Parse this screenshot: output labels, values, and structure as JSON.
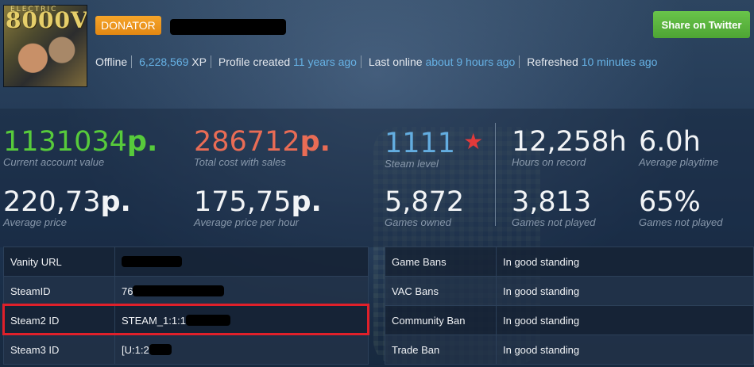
{
  "header": {
    "avatar_text": "8000V",
    "avatar_small": "ELECTRIC",
    "badge": "DONATOR",
    "share_button": "Share on Twitter",
    "status": "Offline",
    "xp_value": "6,228,569",
    "xp_unit": "XP",
    "created_label": "Profile created",
    "created_value": "11 years ago",
    "last_online_label": "Last online",
    "last_online_value": "about 9 hours ago",
    "refreshed_label": "Refreshed",
    "refreshed_value": "10 minutes ago"
  },
  "stats": {
    "account_value": {
      "value": "1131034",
      "currency": "p.",
      "label": "Current account value"
    },
    "total_cost": {
      "value": "286712",
      "currency": "p.",
      "label": "Total cost with sales"
    },
    "steam_level": {
      "value": "1111",
      "label": "Steam level"
    },
    "hours": {
      "value": "12,258h",
      "label": "Hours on record"
    },
    "avg_playtime": {
      "value": "6.0h",
      "label": "Average playtime"
    },
    "avg_price": {
      "value": "220,73",
      "currency": "p.",
      "label": "Average price"
    },
    "price_per_hour": {
      "value": "175,75",
      "currency": "p.",
      "label": "Average price per hour"
    },
    "games_owned": {
      "value": "5,872",
      "label": "Games owned"
    },
    "not_played": {
      "value": "3,813",
      "label": "Games not played"
    },
    "not_played_pct": {
      "value": "65%",
      "label": "Games not played"
    }
  },
  "ids": [
    {
      "key": "Vanity URL",
      "value": ""
    },
    {
      "key": "SteamID",
      "value": "76"
    },
    {
      "key": "Steam2 ID",
      "value": "STEAM_1:1:1"
    },
    {
      "key": "Steam3 ID",
      "value": "[U:1:2"
    }
  ],
  "bans": [
    {
      "key": "Game Bans",
      "value": "In good standing"
    },
    {
      "key": "VAC Bans",
      "value": "In good standing"
    },
    {
      "key": "Community Ban",
      "value": "In good standing"
    },
    {
      "key": "Trade Ban",
      "value": "In good standing"
    }
  ],
  "colors": {
    "accent_green": "#57cb3b",
    "accent_red": "#e96c55",
    "accent_blue": "#63ade0",
    "highlight": "#e0202a",
    "donator": "#f0981f"
  }
}
